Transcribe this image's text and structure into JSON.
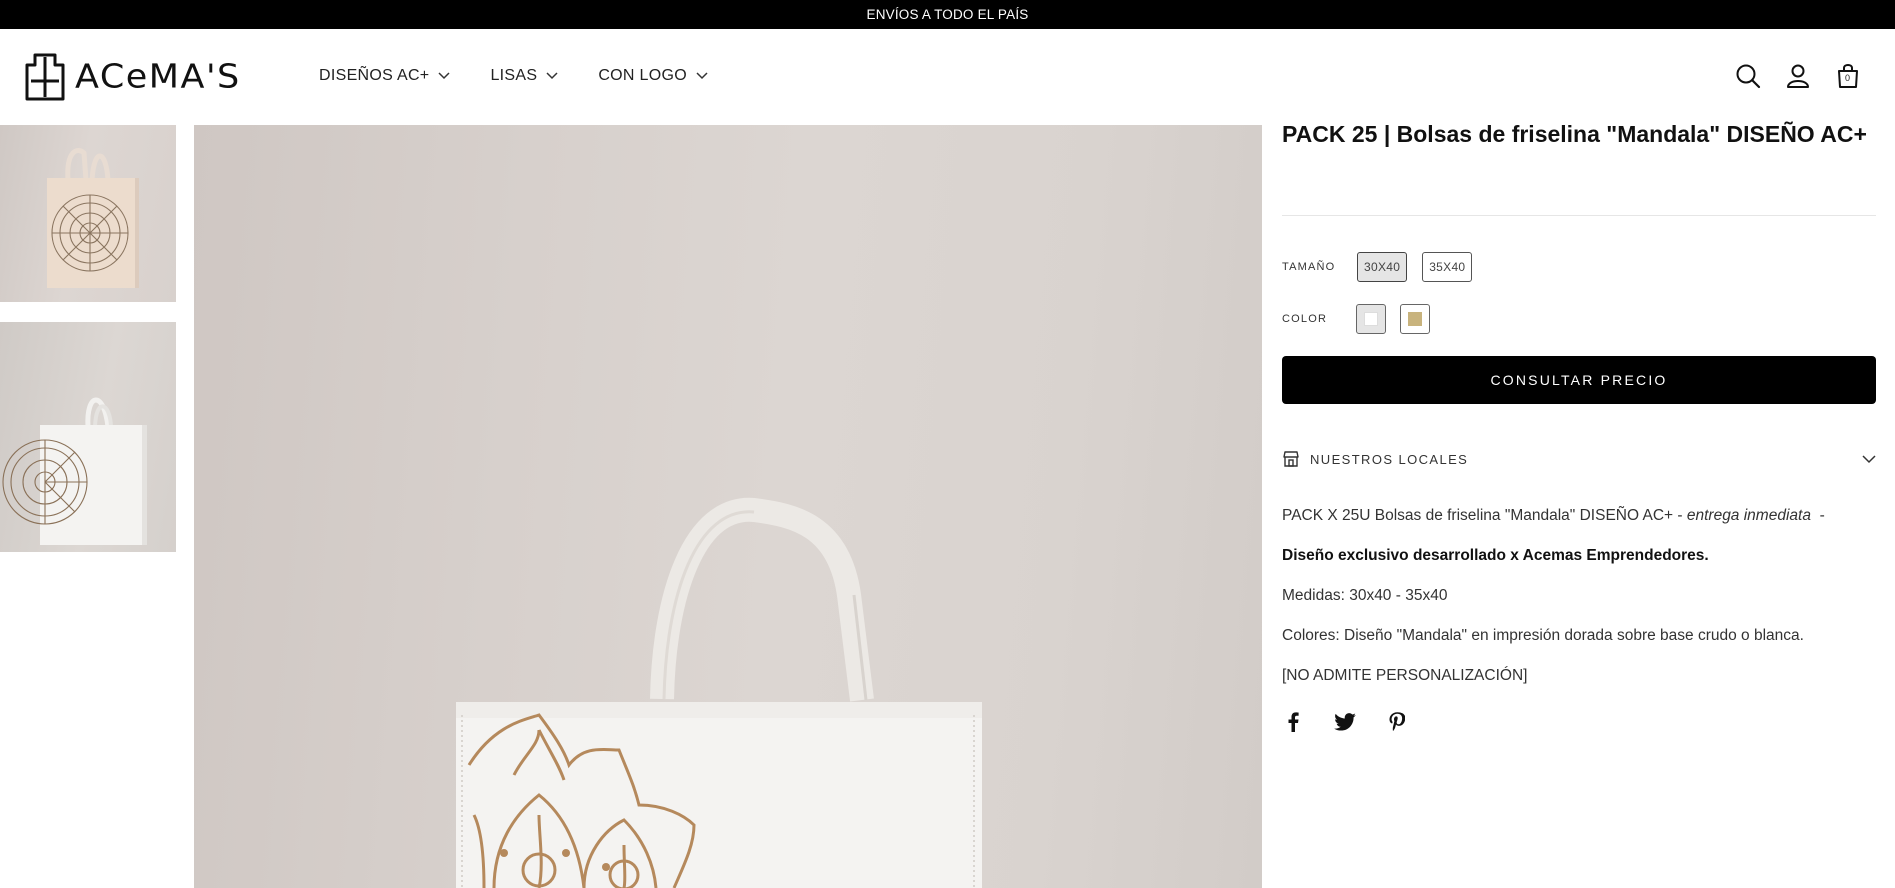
{
  "announcement": "ENVÍOS A TODO EL PAÍS",
  "brand": {
    "name": "ACeMA'S"
  },
  "nav": [
    {
      "label": "DISEÑOS AC+"
    },
    {
      "label": "LISAS"
    },
    {
      "label": "CON LOGO"
    }
  ],
  "header_icons": [
    "search-icon",
    "account-icon",
    "cart-icon"
  ],
  "cart": {
    "count": "0"
  },
  "product": {
    "title": "PACK 25 | Bolsas de friselina \"Mandala\" DISEÑO AC+",
    "size_label": "TAMAÑO",
    "sizes": [
      "30X40",
      "35X40"
    ],
    "selected_size": "30X40",
    "color_label": "COLOR",
    "colors": [
      "#ffffff",
      "#c8b37d"
    ],
    "cta_label": "CONSULTAR PRECIO",
    "locales_label": "NUESTROS LOCALES",
    "description": {
      "line1_main": "PACK X 25U Bolsas de friselina \"Mandala\" DISEÑO AC+ - ",
      "line1_em": "entrega inmediata",
      "line1_tail": "  -",
      "line2": "Diseño exclusivo desarrollado x Acemas Emprendedores.",
      "line3": "Medidas: 30x40 - 35x40",
      "line4": "Colores: Diseño \"Mandala\" en impresión dorada sobre base crudo o blanca.",
      "line5": "[NO ADMITE PERSONALIZACIÓN]"
    }
  },
  "social": [
    "facebook-icon",
    "twitter-icon",
    "pinterest-icon"
  ],
  "colors": {
    "accent": "#000000",
    "gold": "#b0875a"
  }
}
